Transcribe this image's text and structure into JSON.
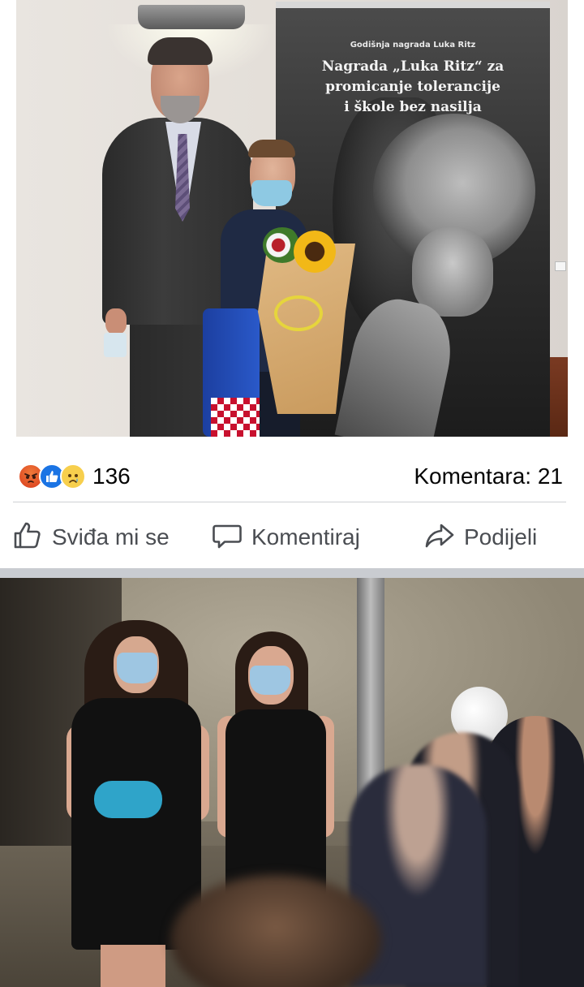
{
  "post1": {
    "photo": {
      "banner_subtitle": "Godišnja nagrada Luka Ritz",
      "banner_title_line1": "Nagrada „Luka Ritz“ za",
      "banner_title_line2": "promicanje tolerancije",
      "banner_title_line3": "i škole bez nasilja"
    },
    "reactions": {
      "icons": [
        "angry-icon",
        "like-icon",
        "sad-icon"
      ],
      "count": "136"
    },
    "comments_label": "Komentara: 21",
    "actions": {
      "like_label": "Sviđa mi se",
      "comment_label": "Komentiraj",
      "share_label": "Podijeli"
    }
  },
  "colors": {
    "like_blue": "#1b74e4",
    "action_gray": "#4a4d52",
    "divider": "#ced0d4",
    "separator": "#c9ccd1"
  }
}
